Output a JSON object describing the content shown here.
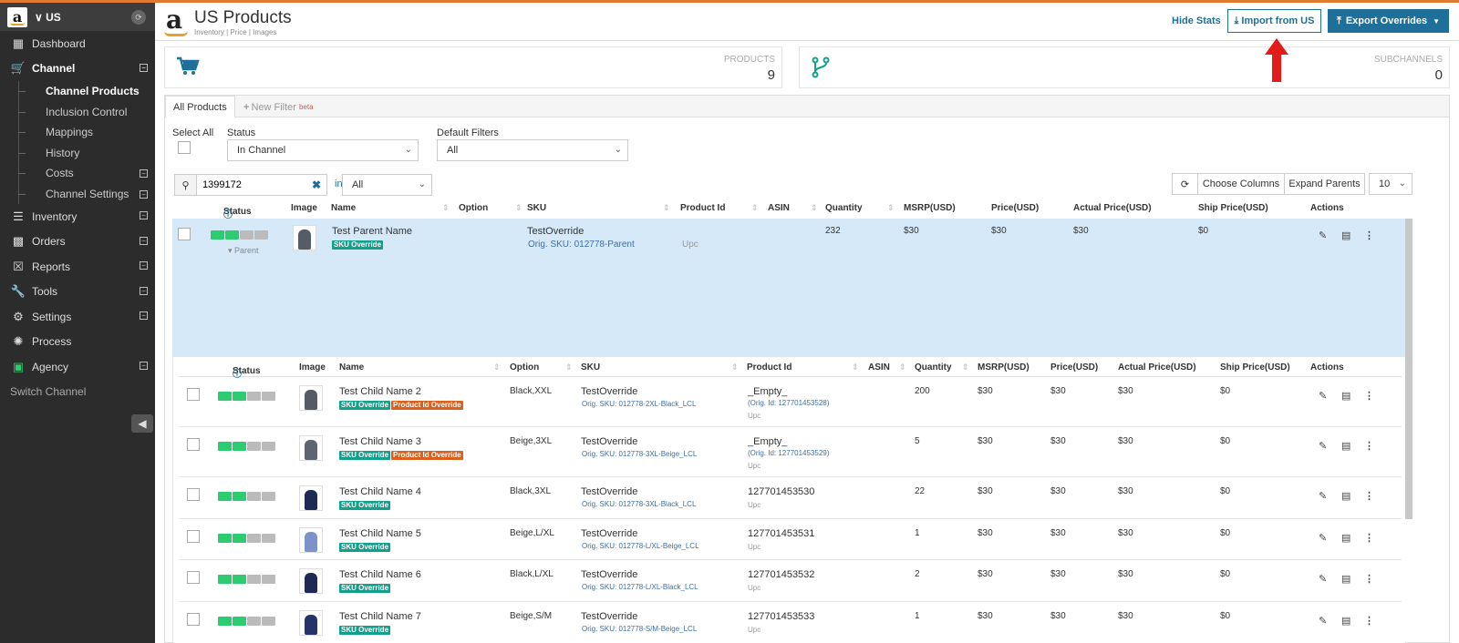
{
  "sidebar": {
    "channel_name": "US",
    "items": [
      {
        "label": "Dashboard",
        "icon": "bar-chart-icon"
      },
      {
        "label": "Channel",
        "icon": "cart-icon",
        "active": true
      },
      {
        "label": "Inventory",
        "icon": "list-icon"
      },
      {
        "label": "Orders",
        "icon": "signal-icon"
      },
      {
        "label": "Reports",
        "icon": "excel-icon"
      },
      {
        "label": "Tools",
        "icon": "wrench-icon"
      },
      {
        "label": "Settings",
        "icon": "gear-icon"
      },
      {
        "label": "Process",
        "icon": "bug-icon"
      },
      {
        "label": "Agency",
        "icon": "monitor-icon"
      }
    ],
    "channel_sub": [
      "Channel Products",
      "Inclusion Control",
      "Mappings",
      "History",
      "Costs",
      "Channel Settings"
    ],
    "switch_channel": "Switch Channel"
  },
  "header": {
    "title": "US Products",
    "subtitle": "Inventory | Price | Images",
    "hide_stats": "Hide Stats",
    "import_label": "Import from US",
    "export_label": "Export Overrides"
  },
  "stats": {
    "products_label": "PRODUCTS",
    "products_value": "9",
    "subchannels_label": "SUBCHANNELS",
    "subchannels_value": "0"
  },
  "tabs": {
    "all": "All Products",
    "new_filter": "New Filter",
    "beta": "beta"
  },
  "filters": {
    "select_all": "Select All",
    "status_label": "Status",
    "status_value": "In Channel",
    "default_label": "Default Filters",
    "default_value": "All",
    "search_value": "1399172",
    "in_label": "in",
    "in_value": "All",
    "choose_columns": "Choose Columns",
    "expand_parents": "Expand Parents",
    "page_size": "10"
  },
  "columns": {
    "status": "Status",
    "image": "Image",
    "name": "Name",
    "option": "Option",
    "sku": "SKU",
    "product_id": "Product Id",
    "asin": "ASIN",
    "quantity": "Quantity",
    "msrp": "MSRP(USD)",
    "price": "Price(USD)",
    "actual_price": "Actual Price(USD)",
    "ship_price": "Ship Price(USD)",
    "actions": "Actions"
  },
  "parent": {
    "name": "Test Parent Name",
    "badge": "SKU Override",
    "sku": "TestOverride",
    "orig_sku": "Orig. SKU: 012778-Parent",
    "product_id_type": "Upc",
    "quantity": "232",
    "msrp": "$30",
    "price": "$30",
    "actual_price": "$30",
    "ship_price": "$0",
    "parent_label": "Parent",
    "status_green": 2
  },
  "children": [
    {
      "name": "Test Child Name 2",
      "badges": [
        "SKU Override",
        "Product Id Override"
      ],
      "option": "Black,XXL",
      "sku": "TestOverride",
      "orig_sku": "Orig. SKU: 012778-2XL-Black_LCL",
      "product_id": "_Empty_",
      "orig_id": "(Orig. Id: 127701453528)",
      "id_type": "Upc",
      "quantity": "200",
      "msrp": "$30",
      "price": "$30",
      "actual_price": "$30",
      "ship_price": "$0",
      "shirt_color": "#555c66"
    },
    {
      "name": "Test Child Name 3",
      "badges": [
        "SKU Override",
        "Product Id Override"
      ],
      "option": "Beige,3XL",
      "sku": "TestOverride",
      "orig_sku": "Orig. SKU: 012778-3XL-Beige_LCL",
      "product_id": "_Empty_",
      "orig_id": "(Orig. Id: 127701453529)",
      "id_type": "Upc",
      "quantity": "5",
      "msrp": "$30",
      "price": "$30",
      "actual_price": "$30",
      "ship_price": "$0",
      "shirt_color": "#5d6570"
    },
    {
      "name": "Test Child Name 4",
      "badges": [
        "SKU Override"
      ],
      "option": "Black,3XL",
      "sku": "TestOverride",
      "orig_sku": "Orig. SKU: 012778-3XL-Black_LCL",
      "product_id": "127701453530",
      "orig_id": "",
      "id_type": "Upc",
      "quantity": "22",
      "msrp": "$30",
      "price": "$30",
      "actual_price": "$30",
      "ship_price": "$0",
      "shirt_color": "#1e2a55"
    },
    {
      "name": "Test Child Name 5",
      "badges": [
        "SKU Override"
      ],
      "option": "Beige,L/XL",
      "sku": "TestOverride",
      "orig_sku": "Orig. SKU: 012778-L/XL-Beige_LCL",
      "product_id": "127701453531",
      "orig_id": "",
      "id_type": "Upc",
      "quantity": "1",
      "msrp": "$30",
      "price": "$30",
      "actual_price": "$30",
      "ship_price": "$0",
      "shirt_color": "#7b93c8"
    },
    {
      "name": "Test Child Name 6",
      "badges": [
        "SKU Override"
      ],
      "option": "Black,L/XL",
      "sku": "TestOverride",
      "orig_sku": "Orig. SKU: 012778-L/XL-Black_LCL",
      "product_id": "127701453532",
      "orig_id": "",
      "id_type": "Upc",
      "quantity": "2",
      "msrp": "$30",
      "price": "$30",
      "actual_price": "$30",
      "ship_price": "$0",
      "shirt_color": "#1e2a55"
    },
    {
      "name": "Test Child Name 7",
      "badges": [
        "SKU Override"
      ],
      "option": "Beige,S/M",
      "sku": "TestOverride",
      "orig_sku": "Orig. SKU: 012778-S/M-Beige_LCL",
      "product_id": "127701453533",
      "orig_id": "",
      "id_type": "Upc",
      "quantity": "1",
      "msrp": "$30",
      "price": "$30",
      "actual_price": "$30",
      "ship_price": "$0",
      "shirt_color": "#25336a"
    }
  ],
  "colors": {
    "accent": "#1e6f9a",
    "sidebar": "#2c2c2c",
    "parent_row": "#d6e9f8",
    "status_green": "#2ecc71",
    "badge_teal": "#12a08a",
    "badge_orange": "#d9601d",
    "arrow": "#e31b1b"
  }
}
